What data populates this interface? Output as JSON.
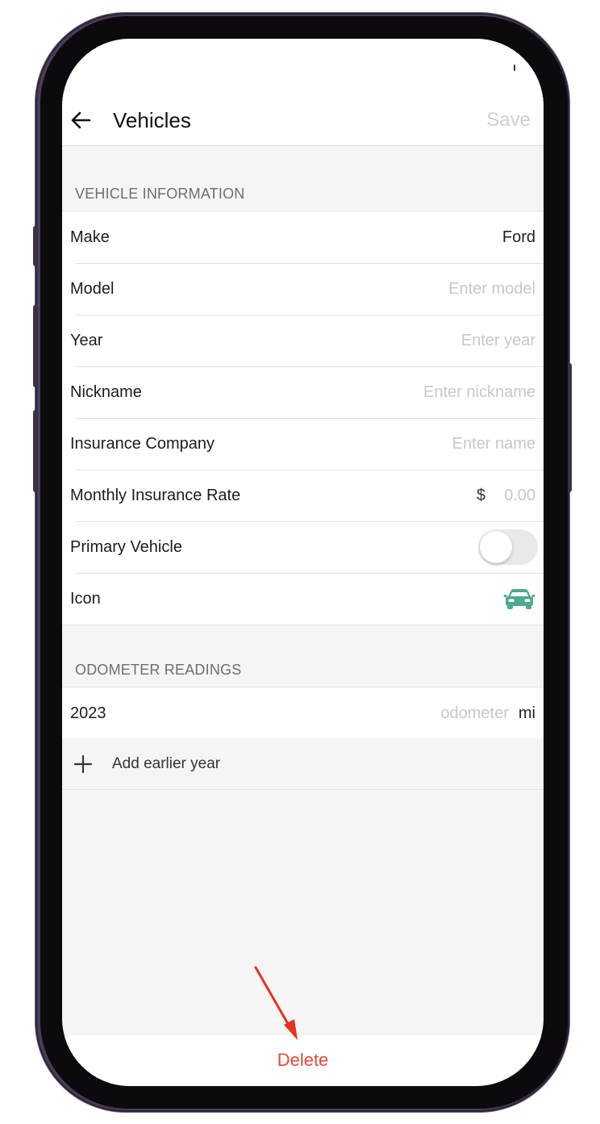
{
  "nav": {
    "title": "Vehicles",
    "save_label": "Save"
  },
  "vehicle_info": {
    "header": "VEHICLE INFORMATION",
    "make": {
      "label": "Make",
      "value": "Ford"
    },
    "model": {
      "label": "Model",
      "placeholder": "Enter model"
    },
    "year": {
      "label": "Year",
      "placeholder": "Enter year"
    },
    "nickname": {
      "label": "Nickname",
      "placeholder": "Enter nickname"
    },
    "insurance_company": {
      "label": "Insurance Company",
      "placeholder": "Enter name"
    },
    "insurance_rate": {
      "label": "Monthly Insurance Rate",
      "currency": "$",
      "placeholder": "0.00"
    },
    "primary_vehicle": {
      "label": "Primary Vehicle",
      "enabled": false
    },
    "icon": {
      "label": "Icon",
      "icon_name": "car-icon",
      "color": "#4daa8d"
    }
  },
  "odometer": {
    "header": "ODOMETER READINGS",
    "readings": [
      {
        "year": "2023",
        "placeholder": "odometer",
        "unit": "mi"
      }
    ],
    "add_label": "Add earlier year"
  },
  "bottom": {
    "delete_label": "Delete"
  },
  "colors": {
    "accent_delete": "#e8473b",
    "annotation_arrow": "#e8321f"
  }
}
